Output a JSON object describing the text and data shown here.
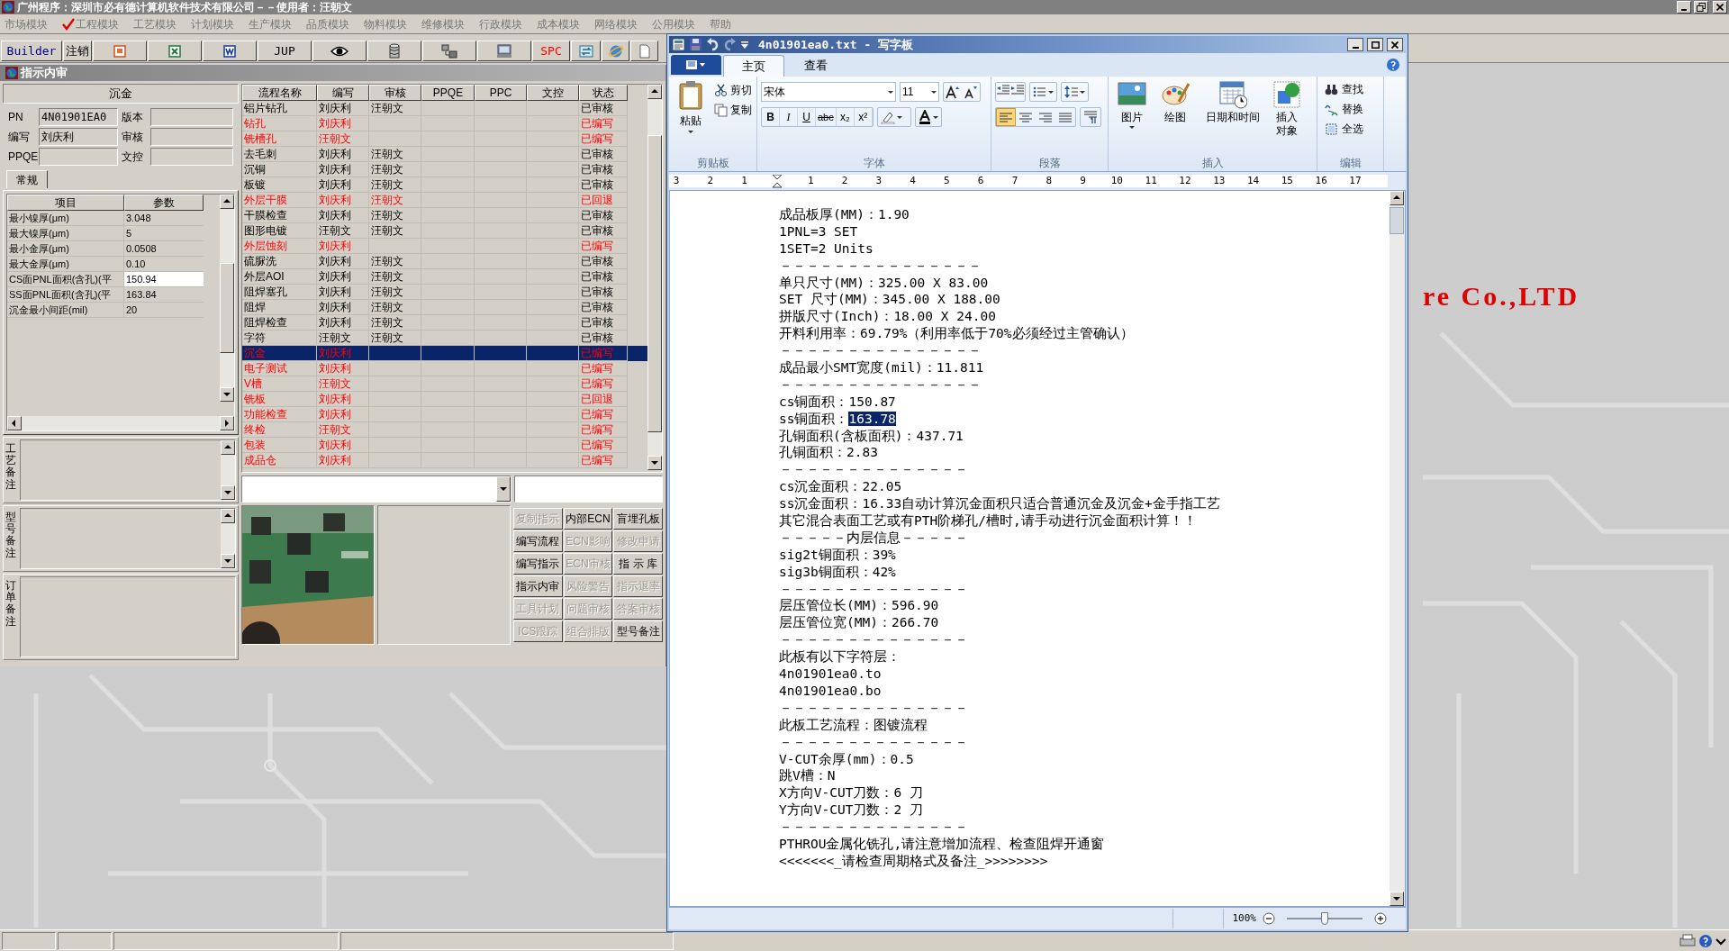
{
  "app": {
    "title": "广州程序：深圳市必有德计算机软件技术有限公司－－使用者：汪朝文",
    "menu": [
      {
        "label": "市场模块",
        "checked": false
      },
      {
        "label": "工程模块",
        "checked": true
      },
      {
        "label": "工艺模块",
        "checked": false
      },
      {
        "label": "计划模块",
        "checked": false
      },
      {
        "label": "生产模块",
        "checked": false
      },
      {
        "label": "品质模块",
        "checked": false
      },
      {
        "label": "物料模块",
        "checked": false
      },
      {
        "label": "维修模块",
        "checked": false
      },
      {
        "label": "行政模块",
        "checked": false
      },
      {
        "label": "成本模块",
        "checked": false
      },
      {
        "label": "网络模块",
        "checked": false
      },
      {
        "label": "公用模块",
        "checked": false
      },
      {
        "label": "帮助",
        "checked": false
      }
    ],
    "toolbar": [
      {
        "kind": "text",
        "label": "Builder",
        "color": "#00008b"
      },
      {
        "kind": "text",
        "label": "注销"
      },
      {
        "kind": "slides"
      },
      {
        "kind": "sheet"
      },
      {
        "kind": "doc"
      },
      {
        "kind": "text",
        "label": "JUP"
      },
      {
        "kind": "eye"
      },
      {
        "kind": "database"
      },
      {
        "kind": "network"
      },
      {
        "kind": "computer"
      },
      {
        "kind": "text",
        "label": "SPC",
        "color": "#ff0000"
      },
      {
        "kind": "swap"
      },
      {
        "kind": "globe"
      },
      {
        "kind": "page"
      }
    ],
    "backdrop_text": "re Co.,LTD"
  },
  "review_window": {
    "title": "指示内审",
    "section": "沉金",
    "fields": [
      {
        "label": "PN",
        "value": "4N01901EA0"
      },
      {
        "label": "版本"
      },
      {
        "label": "编写",
        "value": "刘庆利"
      },
      {
        "label": "审核"
      },
      {
        "label": "PPQE"
      },
      {
        "label": "文控"
      }
    ],
    "tabs": [
      {
        "label": "常规",
        "selected": true
      }
    ],
    "params": {
      "columns": [
        "项目",
        "参数"
      ],
      "rows": [
        {
          "item": "最小镍厚(μm)",
          "value": "3.048",
          "selected": false
        },
        {
          "item": "最大镍厚(μm)",
          "value": "5",
          "selected": false
        },
        {
          "item": "最小金厚(μm)",
          "value": "0.0508",
          "selected": false
        },
        {
          "item": "最大金厚(μm)",
          "value": "0.10",
          "selected": false
        },
        {
          "item": "CS面PNL面积(含孔)(平",
          "value": "150.94",
          "selected": true
        },
        {
          "item": "SS面PNL面积(含孔)(平",
          "value": "163.84",
          "selected": false
        },
        {
          "item": "沉金最小间距(mil)",
          "value": "20",
          "selected": false
        }
      ]
    },
    "notes": [
      "工艺备注",
      "型号备注",
      "订单备注"
    ],
    "flow": {
      "columns": [
        "流程名称",
        "编写",
        "审核",
        "PPQE",
        "PPC",
        "文控",
        "状态"
      ],
      "rows": [
        {
          "name": "铝片钻孔",
          "writer": "刘庆利",
          "reviewer": "汪朝文",
          "status": "已审核",
          "flagged": false,
          "selected": false
        },
        {
          "name": "钻孔",
          "writer": "刘庆利",
          "status": "已编写",
          "flagged": true,
          "selected": false
        },
        {
          "name": "铣槽孔",
          "writer": "汪朝文",
          "status": "已编写",
          "flagged": true,
          "selected": false
        },
        {
          "name": "去毛刺",
          "writer": "刘庆利",
          "reviewer": "汪朝文",
          "status": "已审核",
          "flagged": false,
          "selected": false
        },
        {
          "name": "沉铜",
          "writer": "刘庆利",
          "reviewer": "汪朝文",
          "status": "已审核",
          "flagged": false,
          "selected": false
        },
        {
          "name": "板镀",
          "writer": "刘庆利",
          "reviewer": "汪朝文",
          "status": "已审核",
          "flagged": false,
          "selected": false
        },
        {
          "name": "外层干膜",
          "writer": "刘庆利",
          "reviewer": "汪朝文",
          "status": "已回退",
          "flagged": true,
          "selected": false
        },
        {
          "name": "干膜检查",
          "writer": "刘庆利",
          "reviewer": "汪朝文",
          "status": "已审核",
          "flagged": false,
          "selected": false
        },
        {
          "name": "图形电镀",
          "writer": "汪朝文",
          "reviewer": "汪朝文",
          "status": "已审核",
          "flagged": false,
          "selected": false
        },
        {
          "name": "外层蚀刻",
          "writer": "刘庆利",
          "status": "已编写",
          "flagged": true,
          "selected": false
        },
        {
          "name": "硫脲洗",
          "writer": "刘庆利",
          "reviewer": "汪朝文",
          "status": "已审核",
          "flagged": false,
          "selected": false
        },
        {
          "name": "外层AOI",
          "writer": "刘庆利",
          "reviewer": "汪朝文",
          "status": "已审核",
          "flagged": false,
          "selected": false
        },
        {
          "name": "阻焊塞孔",
          "writer": "刘庆利",
          "reviewer": "汪朝文",
          "status": "已审核",
          "flagged": false,
          "selected": false
        },
        {
          "name": "阻焊",
          "writer": "刘庆利",
          "reviewer": "汪朝文",
          "status": "已审核",
          "flagged": false,
          "selected": false
        },
        {
          "name": "阻焊检查",
          "writer": "刘庆利",
          "reviewer": "汪朝文",
          "status": "已审核",
          "flagged": false,
          "selected": false
        },
        {
          "name": "字符",
          "writer": "汪朝文",
          "reviewer": "汪朝文",
          "status": "已审核",
          "flagged": false,
          "selected": false
        },
        {
          "name": "沉金",
          "writer": "刘庆利",
          "status": "已编写",
          "flagged": true,
          "selected": true
        },
        {
          "name": "电子测试",
          "writer": "刘庆利",
          "status": "已编写",
          "flagged": true,
          "selected": false
        },
        {
          "name": "V槽",
          "writer": "汪朝文",
          "status": "已编写",
          "flagged": true,
          "selected": false
        },
        {
          "name": "铣板",
          "writer": "刘庆利",
          "status": "已回退",
          "flagged": true,
          "selected": false
        },
        {
          "name": "功能检查",
          "writer": "刘庆利",
          "status": "已编写",
          "flagged": true,
          "selected": false
        },
        {
          "name": "终检",
          "writer": "汪朝文",
          "status": "已编写",
          "flagged": true,
          "selected": false
        },
        {
          "name": "包装",
          "writer": "刘庆利",
          "status": "已编写",
          "flagged": true,
          "selected": false
        },
        {
          "name": "成品仓",
          "writer": "刘庆利",
          "status": "已编写",
          "flagged": true,
          "selected": false
        }
      ]
    },
    "photo": {
      "kind": "picture"
    },
    "buttons": [
      {
        "label": "复制指示",
        "disabled": true
      },
      {
        "label": "内部ECN",
        "disabled": false
      },
      {
        "label": "盲埋孔板",
        "disabled": false
      },
      {
        "label": "编写流程",
        "disabled": false
      },
      {
        "label": "ECN影响",
        "disabled": true
      },
      {
        "label": "修改申请",
        "disabled": true
      },
      {
        "label": "编写指示",
        "disabled": false
      },
      {
        "label": "ECN审核",
        "disabled": true
      },
      {
        "label": "指 示 库",
        "disabled": false
      },
      {
        "label": "指示内审",
        "disabled": false
      },
      {
        "label": "风险警告",
        "disabled": true
      },
      {
        "label": "指示退率",
        "disabled": true
      },
      {
        "label": "工具计划",
        "disabled": true
      },
      {
        "label": "问题审核",
        "disabled": true
      },
      {
        "label": "答案审核",
        "disabled": true
      },
      {
        "label": "ICS跟踪",
        "disabled": true
      },
      {
        "label": "组合排版",
        "disabled": true
      },
      {
        "label": "型号备注",
        "disabled": false
      }
    ]
  },
  "wordpad": {
    "title": "4n01901ea0.txt - 写字板",
    "tabs": [
      {
        "label": "主页",
        "selected": true
      },
      {
        "label": "查看",
        "selected": false
      }
    ],
    "clipboard": {
      "paste": "粘贴",
      "cut": "剪切",
      "copy": "复制",
      "label": "剪贴板"
    },
    "font": {
      "family": "宋体",
      "size": "11",
      "styles": [
        "B",
        "I",
        "U",
        "abc",
        "x₂",
        "x²"
      ],
      "label": "字体"
    },
    "paragraph": {
      "label": "段落",
      "alignment": [
        {
          "selected": true
        },
        {
          "selected": false
        },
        {
          "selected": false
        },
        {
          "selected": false
        }
      ]
    },
    "insert": {
      "label": "插入",
      "items": [
        "图片",
        "绘图",
        "日期和时间",
        "插入对象"
      ]
    },
    "editing": {
      "label": "编辑",
      "items": [
        "查找",
        "替换",
        "全选"
      ]
    },
    "ruler": [
      "3",
      "2",
      "1",
      "1",
      "2",
      "3",
      "4",
      "5",
      "6",
      "7",
      "8",
      "9",
      "10",
      "11",
      "12",
      "13",
      "14",
      "15",
      "16",
      "17"
    ],
    "lines": [
      {
        "text": "成品板厚(MM)：1.90"
      },
      {
        "text": "1PNL=3 SET"
      },
      {
        "text": "1SET=2 Units"
      },
      {
        "text": "－－－－－－－－－－－－－－－"
      },
      {
        "text": "单只尺寸(MM)：325.00 X 83.00"
      },
      {
        "text": "SET 尺寸(MM)：345.00 X 188.00"
      },
      {
        "text": "拼版尺寸(Inch)：18.00 X 24.00"
      },
      {
        "text": "开料利用率：69.79%（利用率低于70%必须经过主管确认）"
      },
      {
        "text": "－－－－－－－－－－－－－－－"
      },
      {
        "text": "成品最小SMT宽度(mil)：11.811"
      },
      {
        "text": "－－－－－－－－－－－－－－－"
      },
      {
        "text": "cs铜面积：150.87"
      },
      {
        "text": "ss铜面积：",
        "selection": "163.78"
      },
      {
        "text": "孔铜面积(含板面积)：437.71"
      },
      {
        "text": "孔铜面积：2.83"
      },
      {
        "text": "－－－－－－－－－－－－－－"
      },
      {
        "text": "cs沉金面积：22.05"
      },
      {
        "text": "ss沉金面积：16.33自动计算沉金面积只适合普通沉金及沉金+金手指工艺"
      },
      {
        "text": "其它混合表面工艺或有PTH阶梯孔/槽时,请手动进行沉金面积计算！！"
      },
      {
        "text": "－－－－－内层信息－－－－－"
      },
      {
        "text": "sig2t铜面积：39%"
      },
      {
        "text": "sig3b铜面积：42%"
      },
      {
        "text": "－－－－－－－－－－－－－－"
      },
      {
        "text": "层压管位长(MM)：596.90"
      },
      {
        "text": "层压管位宽(MM)：266.70"
      },
      {
        "text": "－－－－－－－－－－－－－－"
      },
      {
        "text": "此板有以下字符层："
      },
      {
        "text": "4n01901ea0.to"
      },
      {
        "text": "4n01901ea0.bo"
      },
      {
        "text": "－－－－－－－－－－－－－－"
      },
      {
        "text": "此板工艺流程：图镀流程"
      },
      {
        "text": "－－－－－－－－－－－－－－"
      },
      {
        "text": "V-CUT余厚(mm)：0.5"
      },
      {
        "text": "跳V槽：N"
      },
      {
        "text": "X方向V-CUT刀数：6 刀"
      },
      {
        "text": "Y方向V-CUT刀数：2 刀"
      },
      {
        "text": "－－－－－－－－－－－－－－"
      },
      {
        "text": "PTHROU金属化铣孔,请注意增加流程、检查阻焊开通窗"
      },
      {
        "text": "<<<<<<<_请检查周期格式及备注_>>>>>>>>"
      }
    ],
    "zoom": {
      "reading": "100%",
      "level": 0.5
    }
  }
}
